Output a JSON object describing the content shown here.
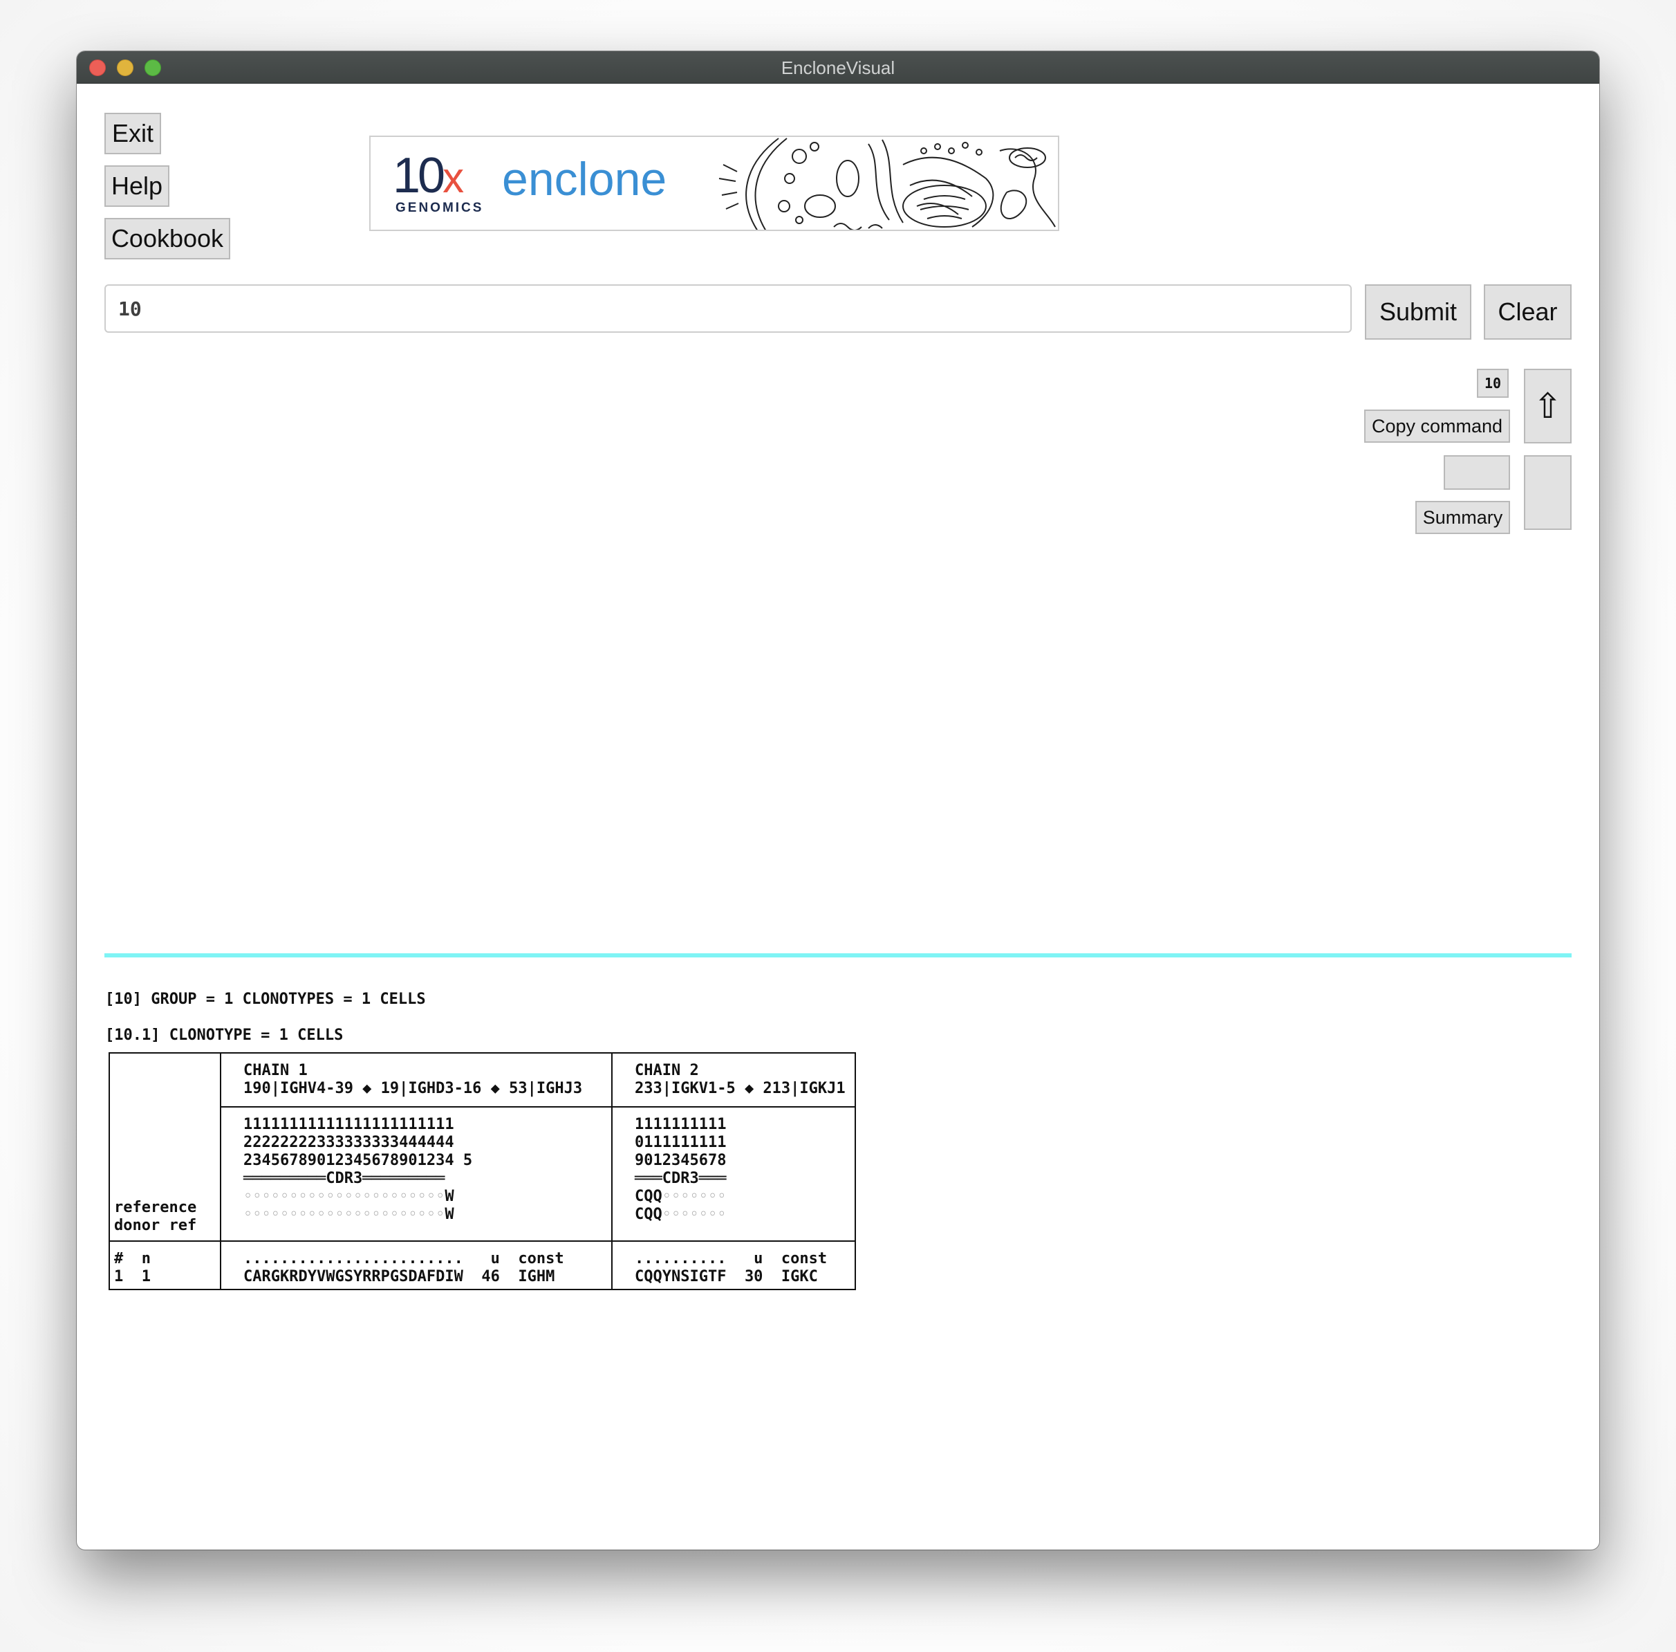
{
  "window": {
    "title": "EncloneVisual"
  },
  "nav": {
    "exit_label": "Exit",
    "help_label": "Help",
    "cookbook_label": "Cookbook"
  },
  "banner": {
    "brand_number": "10",
    "brand_x": "x",
    "brand_sub": "GENOMICS",
    "product": "enclone"
  },
  "command": {
    "value": "10",
    "submit_label": "Submit",
    "clear_label": "Clear"
  },
  "side": {
    "command_badge": "10",
    "copy_label": "Copy command",
    "summary_label": "Summary",
    "up_arrow": "⇧"
  },
  "output": {
    "group_line": "[10] GROUP = 1 CLONOTYPES = 1 CELLS",
    "clonotype_line": "[10.1] CLONOTYPE = 1 CELLS",
    "table": {
      "left_labels": [
        "reference",
        "donor ref"
      ],
      "left_header": "#  n",
      "left_row": "1  1",
      "chain1": {
        "title": "CHAIN 1",
        "genes": "190|IGHV4-39 ◆ 19|IGHD3-16 ◆ 53|IGHJ3",
        "pos1": "11111111111111111111111",
        "pos2": "22222222333333333444444",
        "pos3": "23456789012345678901234 5",
        "cdr3": "═════════CDR3═════════",
        "reference_dots": "◦◦◦◦◦◦◦◦◦◦◦◦◦◦◦◦◦◦◦◦◦◦",
        "reference_end": "W",
        "donor_dots": "◦◦◦◦◦◦◦◦◦◦◦◦◦◦◦◦◦◦◦◦◦◦",
        "donor_end": "W",
        "col_header": "........................   u  const",
        "row": "CARGKRDYVWGSYRRPGSDAFDIW  46  IGHM"
      },
      "chain2": {
        "title": "CHAIN 2",
        "genes": "233|IGKV1-5 ◆ 213|IGKJ1",
        "pos1": "1111111111",
        "pos2": "0111111111",
        "pos3": "9012345678",
        "cdr3": "═══CDR3═══",
        "reference_start": "CQQ",
        "reference_dots": "◦◦◦◦◦◦◦",
        "donor_start": "CQQ",
        "donor_dots": "◦◦◦◦◦◦◦",
        "col_header": "..........   u  const",
        "row": "CQQYNSIGTF  30  IGKC"
      }
    }
  }
}
